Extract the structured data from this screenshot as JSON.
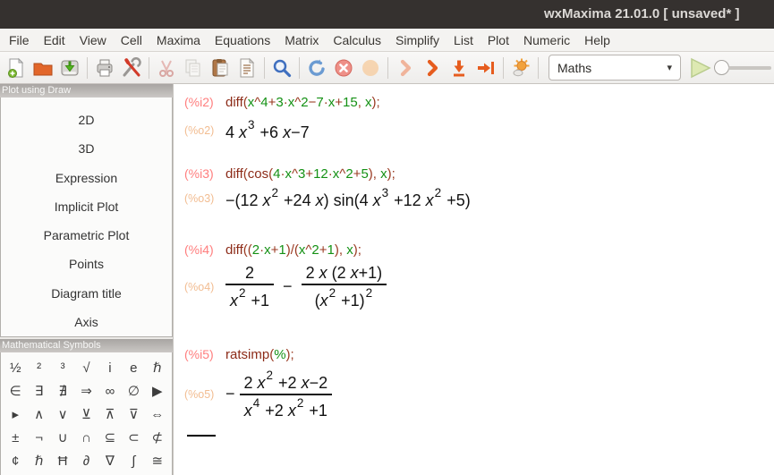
{
  "window": {
    "title": "wxMaxima 21.01.0 [ unsaved* ]"
  },
  "menu": {
    "items": [
      "File",
      "Edit",
      "View",
      "Cell",
      "Maxima",
      "Equations",
      "Matrix",
      "Calculus",
      "Simplify",
      "List",
      "Plot",
      "Numeric",
      "Help"
    ]
  },
  "toolbar": {
    "icons": [
      "new-document",
      "open",
      "save",
      "print",
      "configure",
      "cut",
      "copy",
      "paste",
      "select-cell",
      "find",
      "restart",
      "interrupt",
      "follow",
      "evaluate-rest",
      "evaluate-cell",
      "evaluate-all",
      "evaluate-to-point",
      "draw"
    ],
    "dropdown_value": "Maths",
    "dropdown_caret": "▾"
  },
  "sidebar": {
    "draw_pane": {
      "title": "Plot using Draw",
      "buttons": [
        "2D",
        "3D",
        "Expression",
        "Implicit Plot",
        "Parametric Plot",
        "Points",
        "Diagram title",
        "Axis"
      ]
    },
    "symbols_pane": {
      "title": "Mathematical Symbols",
      "rows": [
        [
          "½",
          "²",
          "³",
          "√",
          "i",
          "e",
          "ℏ"
        ],
        [
          "∈",
          "∃",
          "∄",
          "⇒",
          "∞",
          "∅",
          "▶"
        ],
        [
          "▸",
          "∧",
          "∨",
          "⊻",
          "⊼",
          "⊽",
          "⇔"
        ],
        [
          "±",
          "¬",
          "∪",
          "∩",
          "⊆",
          "⊂",
          "⊄"
        ],
        [
          "¢",
          "ℏ",
          "Ħ",
          "∂",
          "∇",
          "∫",
          "≅"
        ]
      ]
    }
  },
  "cells": [
    {
      "in_label": "(%i2)",
      "out_label": "(%o2)",
      "input": [
        [
          "diff",
          "f"
        ],
        [
          "(",
          "o"
        ],
        [
          "x",
          "v"
        ],
        [
          "^",
          "o"
        ],
        [
          "4",
          "v"
        ],
        [
          "+",
          "o"
        ],
        [
          "3",
          "v"
        ],
        [
          "·",
          "o"
        ],
        [
          "x",
          "v"
        ],
        [
          "^",
          "o"
        ],
        [
          "2",
          "v"
        ],
        [
          "−",
          "o"
        ],
        [
          "7",
          "v"
        ],
        [
          "·",
          "o"
        ],
        [
          "x",
          "v"
        ],
        [
          "+",
          "o"
        ],
        [
          "15",
          "v"
        ],
        [
          ", ",
          "o"
        ],
        [
          "x",
          "v"
        ],
        [
          ");",
          "o"
        ]
      ],
      "output": [
        {
          "t": "4 "
        },
        {
          "p": [
            "x",
            "3"
          ]
        },
        {
          "t": " +6 "
        },
        {
          "v": "x"
        },
        {
          "t": "−7"
        }
      ]
    },
    {
      "in_label": "(%i3)",
      "out_label": "(%o3)",
      "input": [
        [
          "diff",
          "f"
        ],
        [
          "(",
          "o"
        ],
        [
          "cos",
          "f"
        ],
        [
          "(",
          "o"
        ],
        [
          "4",
          "v"
        ],
        [
          "·",
          "o"
        ],
        [
          "x",
          "v"
        ],
        [
          "^",
          "o"
        ],
        [
          "3",
          "v"
        ],
        [
          "+",
          "o"
        ],
        [
          "12",
          "v"
        ],
        [
          "·",
          "o"
        ],
        [
          "x",
          "v"
        ],
        [
          "^",
          "o"
        ],
        [
          "2",
          "v"
        ],
        [
          "+",
          "o"
        ],
        [
          "5",
          "v"
        ],
        [
          "), ",
          "o"
        ],
        [
          "x",
          "v"
        ],
        [
          ");",
          "o"
        ]
      ],
      "output": [
        {
          "t": "−(12 "
        },
        {
          "p": [
            "x",
            "2"
          ]
        },
        {
          "t": " +24 "
        },
        {
          "v": "x"
        },
        {
          "t": ") sin(4 "
        },
        {
          "p": [
            "x",
            "3"
          ]
        },
        {
          "t": " +12 "
        },
        {
          "p": [
            "x",
            "2"
          ]
        },
        {
          "t": " +5)"
        }
      ]
    },
    {
      "in_label": "(%i4)",
      "out_label": "(%o4)",
      "input": [
        [
          "diff",
          "f"
        ],
        [
          "((",
          "o"
        ],
        [
          "2",
          "v"
        ],
        [
          "·",
          "o"
        ],
        [
          "x",
          "v"
        ],
        [
          "+",
          "o"
        ],
        [
          "1",
          "v"
        ],
        [
          ")/(",
          "o"
        ],
        [
          "x",
          "v"
        ],
        [
          "^",
          "o"
        ],
        [
          "2",
          "v"
        ],
        [
          "+",
          "o"
        ],
        [
          "1",
          "v"
        ],
        [
          "), ",
          "o"
        ],
        [
          "x",
          "v"
        ],
        [
          ");",
          "o"
        ]
      ],
      "output": [
        {
          "f": {
            "n": [
              {
                "t": "2"
              }
            ],
            "d": [
              {
                "p": [
                  "x",
                  "2"
                ]
              },
              {
                "t": " +1"
              }
            ]
          }
        },
        {
          "t": "  −  "
        },
        {
          "f": {
            "n": [
              {
                "t": "2 "
              },
              {
                "v": "x"
              },
              {
                "t": " (2 "
              },
              {
                "v": "x"
              },
              {
                "t": "+1)"
              }
            ],
            "d": [
              {
                "t": "("
              },
              {
                "p": [
                  "x",
                  "2"
                ]
              },
              {
                "t": " +1)"
              },
              {
                "s": "2"
              }
            ]
          }
        }
      ]
    },
    {
      "in_label": "(%i5)",
      "out_label": "(%o5)",
      "input": [
        [
          "ratsimp",
          "f"
        ],
        [
          "(",
          "o"
        ],
        [
          "%",
          "v"
        ],
        [
          ");",
          "o"
        ]
      ],
      "output": [
        {
          "t": "− "
        },
        {
          "f": {
            "n": [
              {
                "t": "2 "
              },
              {
                "p": [
                  "x",
                  "2"
                ]
              },
              {
                "t": " +2 "
              },
              {
                "v": "x"
              },
              {
                "t": "−2"
              }
            ],
            "d": [
              {
                "p": [
                  "x",
                  "4"
                ]
              },
              {
                "t": " +2 "
              },
              {
                "p": [
                  "x",
                  "2"
                ]
              },
              {
                "t": " +1"
              }
            ]
          }
        }
      ]
    }
  ],
  "colors": {
    "titlebar_bg": "#35312f",
    "input_label": "#ff7e7e",
    "output_label": "#f2bd92",
    "function_color": "#8c2b18",
    "operator_color": "#9a3a22",
    "variable_color": "#159115"
  }
}
